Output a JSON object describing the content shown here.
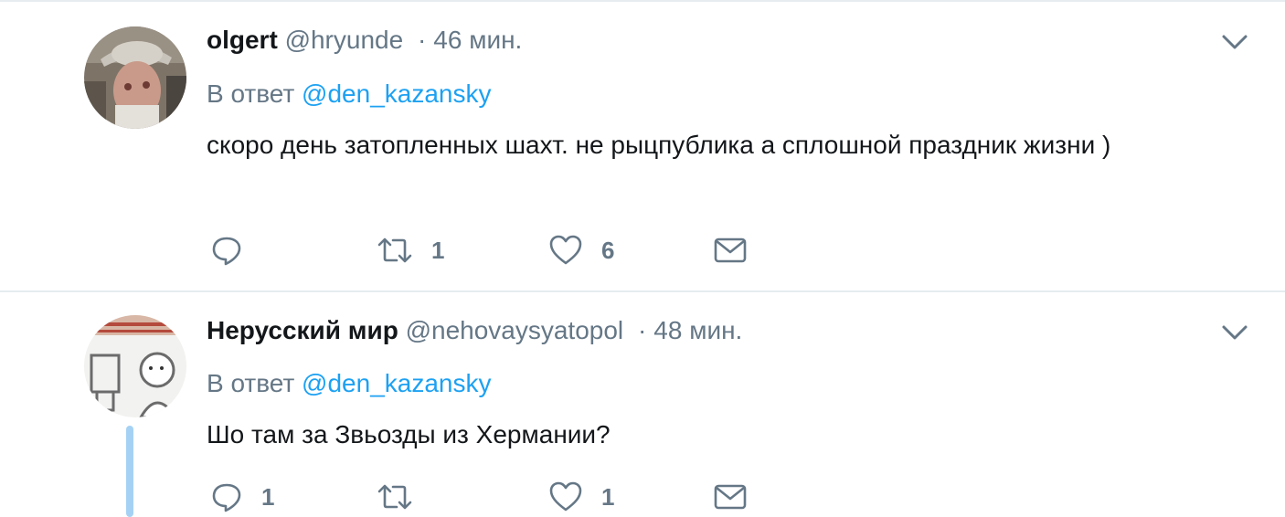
{
  "tweets": [
    {
      "display_name": "olgert",
      "username": "@hryunde",
      "separator": "·",
      "time": "46 мин.",
      "reply_prefix": "В ответ",
      "reply_to": "@den_kazansky",
      "text": "скоро день затопленных шахт. не рыцпублика а сплошной праздник жизни )",
      "replies": "",
      "retweets": "1",
      "likes": "6"
    },
    {
      "display_name": "Нерусский мир",
      "username": "@nehovaysyatopol",
      "separator": "·",
      "time": "48 мин.",
      "reply_prefix": "В ответ",
      "reply_to": "@den_kazansky",
      "text": "Шо там за Звьозды из Хермании?",
      "replies": "1",
      "retweets": "",
      "likes": "1"
    }
  ],
  "icons": {
    "reply": "reply-icon",
    "retweet": "retweet-icon",
    "like": "heart-icon",
    "dm": "envelope-icon",
    "caret": "chevron-down-icon"
  },
  "colors": {
    "text": "#14171a",
    "secondary": "#657786",
    "link": "#1da1f2",
    "thread_line": "#a5d2f4",
    "divider": "#e6ecf0"
  }
}
